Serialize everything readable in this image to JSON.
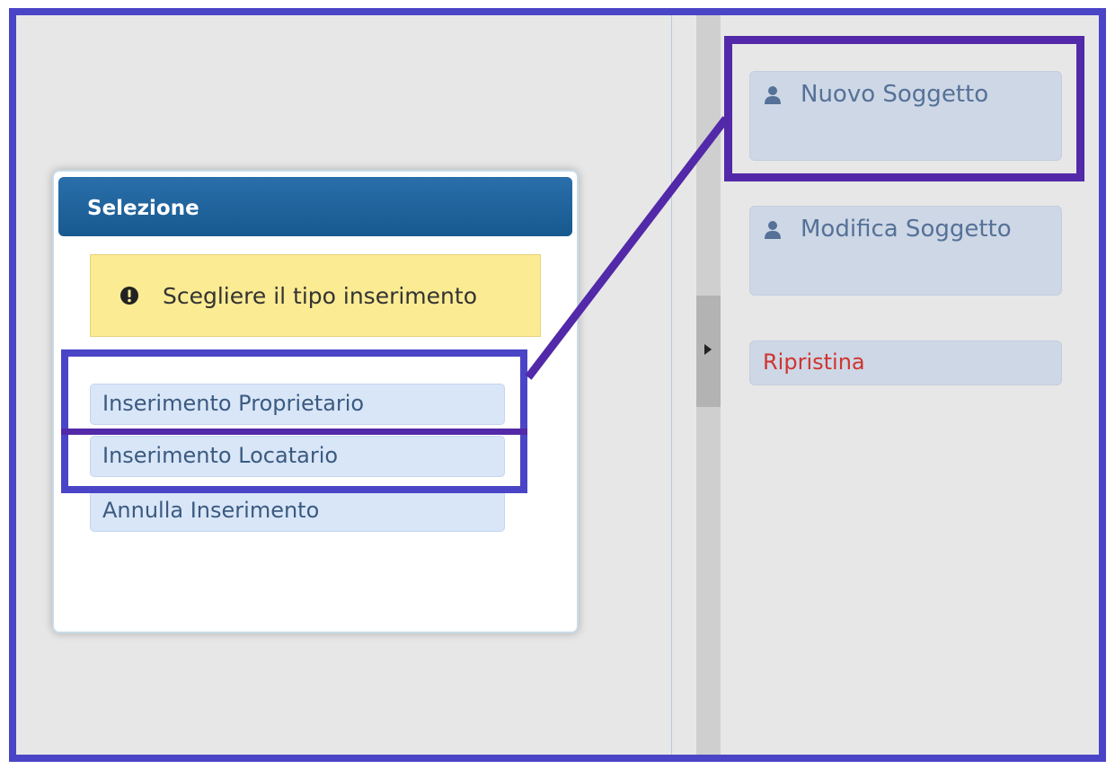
{
  "dialog": {
    "title": "Selezione",
    "notice": "Scegliere il tipo inserimento",
    "options": [
      {
        "label": "Inserimento Proprietario"
      },
      {
        "label": "Inserimento Locatario"
      },
      {
        "label": "Annulla Inserimento"
      }
    ]
  },
  "side_panel": {
    "new_subject": "Nuovo Soggetto",
    "edit_subject": "Modifica Soggetto",
    "reset": "Ripristina"
  },
  "icons": {
    "user": "user-icon",
    "warning": "exclamation-circle-icon",
    "toggle": "caret-right-icon"
  },
  "colors": {
    "annotation": "#4a45c6",
    "annotation_dark": "#5229a8",
    "header": "#1d63a0",
    "notice_bg": "#fbeb93",
    "reset_text": "#d0342f"
  }
}
